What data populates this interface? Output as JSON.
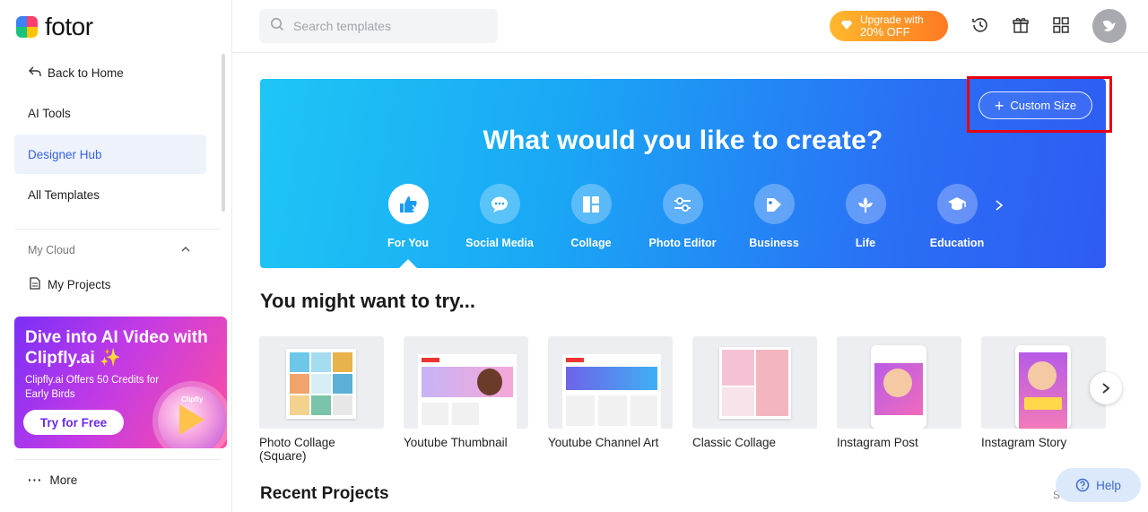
{
  "brand": {
    "name": "fotor"
  },
  "sidebar": {
    "back": "Back to Home",
    "items": [
      {
        "label": "AI Tools"
      },
      {
        "label": "Designer Hub"
      },
      {
        "label": "All Templates"
      }
    ],
    "cloud_section": "My Cloud",
    "my_projects": "My Projects",
    "promo": {
      "title": "Dive into AI Video with Clipfly.ai ✨",
      "subtitle": "Clipfly.ai Offers 50 Credits for Early Birds",
      "button": "Try for Free",
      "coin_label": "Clipfly"
    },
    "more": "More"
  },
  "topbar": {
    "search_placeholder": "Search templates",
    "upgrade_line1": "Upgrade with",
    "upgrade_line2": "20% OFF"
  },
  "hero": {
    "custom_size": "Custom Size",
    "title": "What would you like to create?",
    "categories": [
      {
        "label": "For You",
        "icon": "thumbs-up-icon"
      },
      {
        "label": "Social Media",
        "icon": "chat-bubble-icon"
      },
      {
        "label": "Collage",
        "icon": "collage-icon"
      },
      {
        "label": "Photo Editor",
        "icon": "sliders-icon"
      },
      {
        "label": "Business",
        "icon": "tag-icon"
      },
      {
        "label": "Life",
        "icon": "flower-icon"
      },
      {
        "label": "Education",
        "icon": "graduation-cap-icon"
      }
    ]
  },
  "try_section": {
    "title": "You might want to try...",
    "cards": [
      {
        "label": "Photo Collage (Square)"
      },
      {
        "label": "Youtube Thumbnail"
      },
      {
        "label": "Youtube Channel Art"
      },
      {
        "label": "Classic Collage"
      },
      {
        "label": "Instagram Post"
      },
      {
        "label": "Instagram Story"
      }
    ]
  },
  "recent": {
    "title": "Recent Projects",
    "cut_text": "S"
  },
  "help": {
    "label": "Help"
  },
  "colors": {
    "accent": "#3860e8",
    "hero_start": "#1ec6f5",
    "hero_end": "#2e5bf2",
    "upgrade": "#ff7a22",
    "highlight": "#e60012"
  }
}
